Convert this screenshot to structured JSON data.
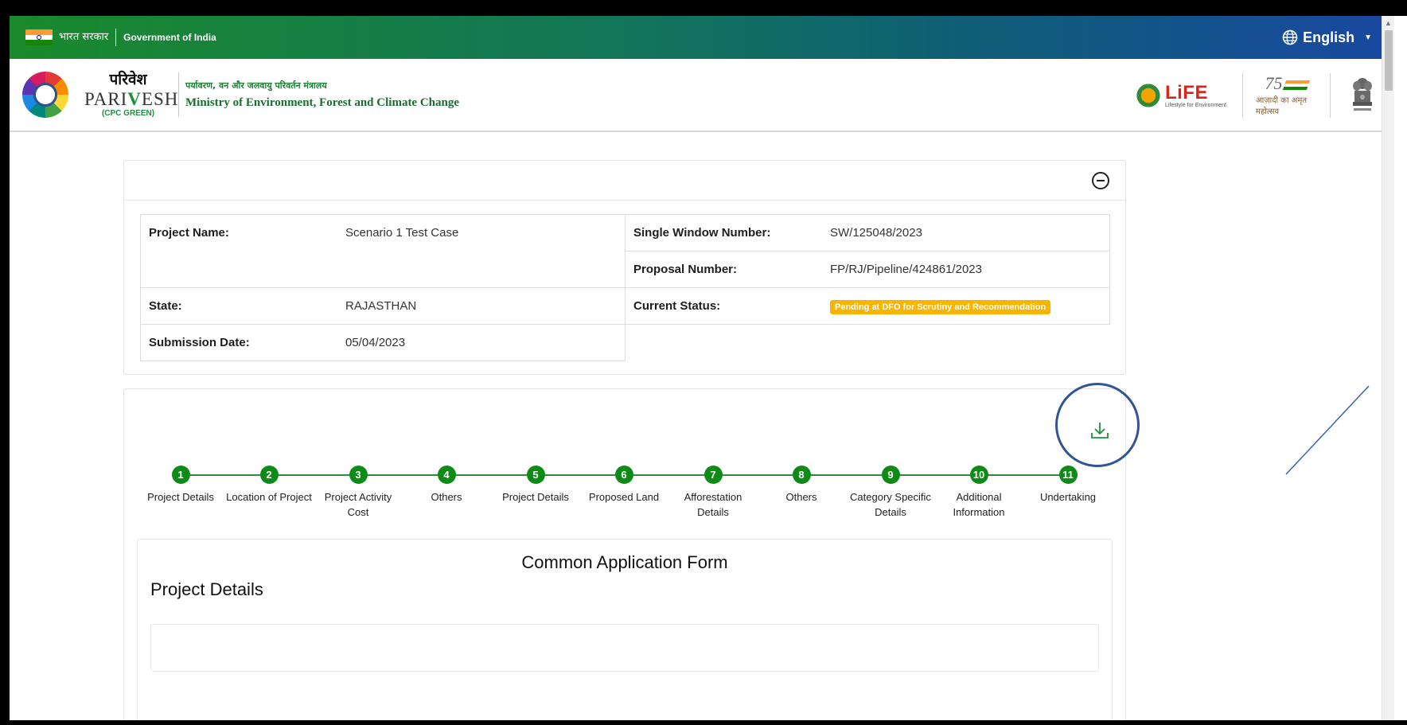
{
  "govbar": {
    "hindi_label": "भारत सरकार",
    "english_label": "Government of India",
    "language": "English"
  },
  "brand": {
    "hindi_name": "परिवेश",
    "english_name_pre": "PARI",
    "english_name_v": "V",
    "english_name_post": "ESH",
    "sub_label": "(CPC GREEN)",
    "ministry_hindi": "पर्यावरण, वन और जलवायु परिवर्तन मंत्रालय",
    "ministry_english": "Ministry of Environment, Forest and Climate Change"
  },
  "partner_logos": {
    "life_title": "LiFE",
    "life_tagline": "Lifestyle for Environment",
    "azadi_number": "75",
    "azadi_text": "आज़ादी का अमृत महोत्सव"
  },
  "summary": {
    "left": [
      {
        "label": "Project Name:",
        "value": "Scenario 1 Test Case"
      },
      {
        "label": "State:",
        "value": "RAJASTHAN"
      },
      {
        "label": "Submission Date:",
        "value": "05/04/2023"
      }
    ],
    "right": [
      {
        "label": "Single Window Number:",
        "value": "SW/125048/2023"
      },
      {
        "label": "Proposal Number:",
        "value": "FP/RJ/Pipeline/424861/2023"
      },
      {
        "label": "Current Status:",
        "value": "Pending at DFO for Scrutiny and Recommendation"
      }
    ],
    "status_color": "#f8b400"
  },
  "steps": [
    {
      "num": "1",
      "label": "Project Details"
    },
    {
      "num": "2",
      "label": "Location of Project"
    },
    {
      "num": "3",
      "label": "Project Activity Cost"
    },
    {
      "num": "4",
      "label": "Others"
    },
    {
      "num": "5",
      "label": "Project Details"
    },
    {
      "num": "6",
      "label": "Proposed Land"
    },
    {
      "num": "7",
      "label": "Afforestation Details"
    },
    {
      "num": "8",
      "label": "Others"
    },
    {
      "num": "9",
      "label": "Category Specific Details"
    },
    {
      "num": "10",
      "label": "Additional Information"
    },
    {
      "num": "11",
      "label": "Undertaking"
    }
  ],
  "form": {
    "title": "Common Application Form",
    "section": "Project Details"
  },
  "colors": {
    "step_green": "#0e8a16",
    "annotation_blue": "#2f5597"
  }
}
